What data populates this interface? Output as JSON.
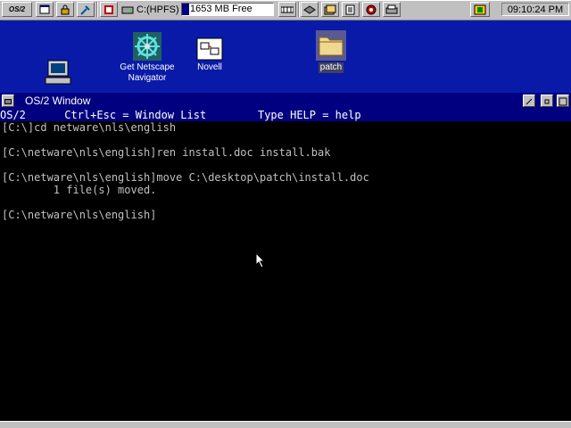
{
  "taskbar": {
    "logo": "OS/2",
    "drive_label": "C:(HPFS)",
    "free_space": "1653 MB Free",
    "free_fill_fraction": 0.08,
    "clock": "09:10:24 PM"
  },
  "desktop_icons": [
    {
      "label": "",
      "icon": "computer-icon"
    },
    {
      "label": "Get Netscape Navigator",
      "icon": "netscape-wheel-icon"
    },
    {
      "label": "Novell",
      "icon": "novell-network-icon"
    },
    {
      "label": "patch",
      "icon": "folder-icon"
    }
  ],
  "window": {
    "title": "OS/2 Window",
    "status_line": "OS/2      Ctrl+Esc = Window List        Type HELP = help",
    "console_lines": [
      "[C:\\]cd netware\\nls\\english",
      "",
      "[C:\\netware\\nls\\english]ren install.doc install.bak",
      "",
      "[C:\\netware\\nls\\english]move C:\\desktop\\patch\\install.doc",
      "        1 file(s) moved.",
      "",
      "[C:\\netware\\nls\\english]"
    ]
  },
  "colors": {
    "desktop": "#0a1aa8",
    "titlebar": "#000080",
    "console_bg": "#000000",
    "console_fg": "#c0c0c0"
  }
}
